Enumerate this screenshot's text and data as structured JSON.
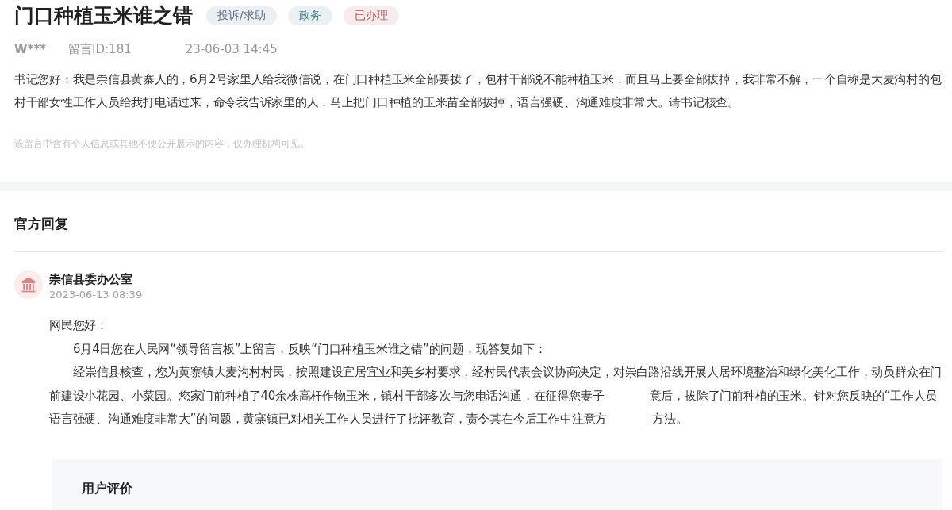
{
  "post": {
    "title": "门口种植玉米谁之错",
    "tags": [
      {
        "label": "投诉/求助",
        "color": "#5b6b86"
      },
      {
        "label": "政务",
        "color": "#4a7f94"
      },
      {
        "label": "已办理",
        "color": "#b4525e"
      }
    ],
    "author": "W***",
    "message_id": "留言ID:181",
    "time": "23-06-03 14:45",
    "body": "书记您好：我是崇信县黄寨人的，6月2号家里人给我微信说，在门口种植玉米全部要拨了，包村干部说不能种植玉米，而且马上要全部拔掉，我非常不解，一个自称是大麦沟村的包村干部女性工作人员给我打电话过来，命令我告诉家里的人，马上把门口种植的玉米苗全部拔掉，语言强硬、沟通难度非常大。请书记核查。",
    "privacy_note": "该留言中含有个人信息或其他不便公开展示的内容，仅办理机构可见。"
  },
  "official_reply": {
    "heading": "官方回复",
    "office": "崇信县委办公室",
    "time": "2023-06-13 08:39",
    "greeting": "网民您好：",
    "paragraphs": [
      {
        "parts": [
          "6月4日您在人民网“领导留言板”上留言，反映“门口种植玉米谁之错”的问题，现答复如下："
        ]
      },
      {
        "parts": [
          "经崇信县核查，您为黄寨镇大麦沟村村民，按照建设宜居宜业和美乡村要求，经村民代表会议协商决定，对崇白路沿线开展人居环境整治和绿化美化工作，动员群众在门前建设小花园、小菜园。您家门前种植了40余株高杆作物玉米，镇村干部多次与您电话沟通，在征得您妻子",
          "意后，拔除了门前种植的玉米。针对您反映的“工作人员语言强硬、沟通难度非常大”的问题，黄寨镇已对相关工作人员进行了批评教育，责令其在今后工作中注意方",
          "方法。"
        ]
      }
    ]
  },
  "user_rating": {
    "heading": "用户评价"
  }
}
